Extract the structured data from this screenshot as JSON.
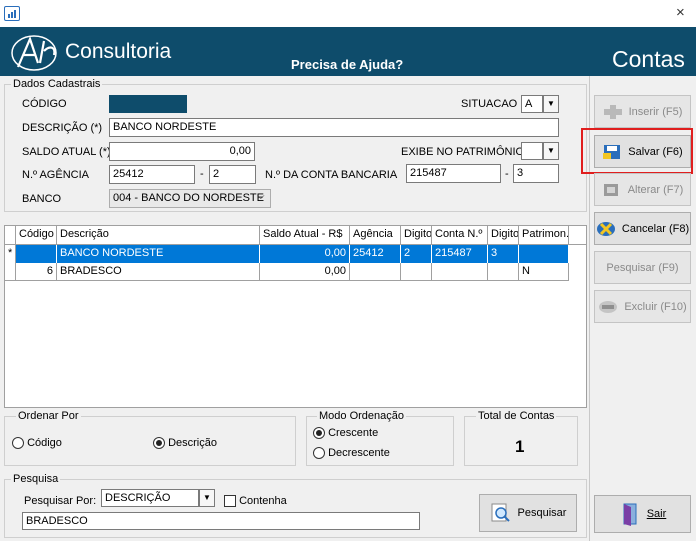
{
  "window": {
    "close_glyph": "×"
  },
  "header": {
    "brand": "Consultoria",
    "help": "Precisa de Ajuda?",
    "screen_title": "Contas"
  },
  "dados": {
    "legend": "Dados Cadastrais",
    "codigo_label": "CÓDIGO",
    "descricao_label": "DESCRIÇÃO (*)",
    "descricao_value": "BANCO NORDESTE",
    "saldo_label": "SALDO ATUAL (*)",
    "saldo_value": "0,00",
    "agencia_label": "N.º AGÊNCIA",
    "agencia_value": "25412",
    "agencia_digito": "2",
    "dash": "-",
    "conta_label": "N.º DA CONTA BANCARIA",
    "conta_value": "215487",
    "conta_digito": "3",
    "banco_label": "BANCO",
    "banco_value": "004 - BANCO DO NORDESTE",
    "situacao_label": "SITUACAO",
    "situacao_value": "A",
    "exibe_label": "EXIBE NO PATRIMÔNIO",
    "exibe_value": "",
    "codigo_color": "#0e4c6b"
  },
  "grid": {
    "columns": [
      "Código",
      "Descrição",
      "Saldo Atual - R$",
      "Agência",
      "Digito",
      "Conta N.º",
      "Digito",
      "Patrimon."
    ],
    "rows": [
      {
        "indicator": "*",
        "cells": [
          "",
          "BANCO NORDESTE",
          "0,00",
          "25412",
          "2",
          "215487",
          "3",
          ""
        ]
      },
      {
        "indicator": "",
        "cells": [
          "6",
          "BRADESCO",
          "0,00",
          "",
          "",
          "",
          "",
          "N"
        ]
      }
    ]
  },
  "ordenar": {
    "legend": "Ordenar Por",
    "codigo": "Código",
    "descricao": "Descrição",
    "selected": "descricao"
  },
  "modo": {
    "legend": "Modo Ordenação",
    "crescente": "Crescente",
    "decrescente": "Decrescente",
    "selected": "crescente"
  },
  "total": {
    "label": "Total de Contas",
    "value": "1"
  },
  "pesquisa": {
    "legend": "Pesquisa",
    "por_label": "Pesquisar Por:",
    "por_value": "DESCRIÇÃO",
    "contenha_label": "Contenha",
    "query": "BRADESCO",
    "button": "Pesquisar"
  },
  "sidebar": {
    "inserir": "Inserir (F5)",
    "salvar": "Salvar (F6)",
    "alterar": "Alterar (F7)",
    "cancelar": "Cancelar (F8)",
    "pesquisar": "Pesquisar (F9)",
    "excluir": "Excluir (F10)",
    "sair": "Sair"
  },
  "colors": {
    "header": "#0e4c6b",
    "selection": "#0078d7",
    "highlight": "#e01e1e"
  }
}
